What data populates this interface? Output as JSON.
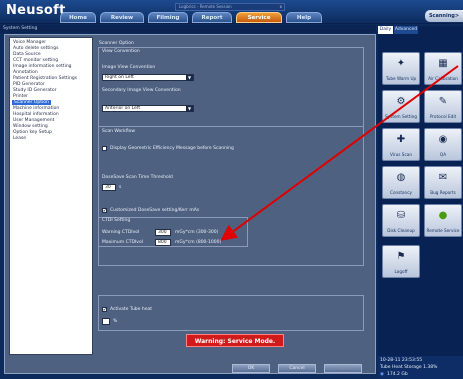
{
  "app": {
    "brand": "Neusoft"
  },
  "nav": {
    "tabs": [
      "Home",
      "Review",
      "Filming",
      "Report",
      "Service",
      "Help"
    ],
    "active": "Service",
    "log_window": "Logbrics - Remote Session",
    "close_glyph": "x",
    "scanning_button": "Scanning>"
  },
  "window_title": "System Setting",
  "tree": {
    "items": [
      "Voice Manager",
      "Auto delete settings",
      "Data Source",
      "CCT monitor setting",
      "Image information setting",
      "Annotation",
      "Patient Registration Settings",
      "PID Generator",
      "Study ID Generator",
      "Printer",
      "Scanner Option",
      "Machine information",
      "Hospital information",
      "User Management",
      "Window setting",
      "Option key Setup",
      "Lease"
    ],
    "selected": "Scanner Option"
  },
  "scanner_option": {
    "header": "Scanner Option",
    "view_convention": {
      "title": "View Convention",
      "image_label": "Image View Convention",
      "image_value": "Right on Left",
      "secondary_label": "Secondary Image View Convention",
      "secondary_value": "Anterior on Left"
    },
    "scan_workflow": {
      "title": "Scan Workflow",
      "display_geometric": "Display Geometric Efficiency Message before Scanning",
      "display_geometric_checked": false,
      "dose_save_label": "DoseSave Scan Time Threshold",
      "dose_save_value": "30",
      "dose_save_unit": "s",
      "customized_dosesave": "Customized DoseSave setting/Kerr mAs",
      "customized_dosesave_checked": true
    },
    "ctdi": {
      "title": "CTDI Setting",
      "warning_label": "Warning CTDIvol",
      "warning_value": "300",
      "warning_range": "mGy*cm (300-300)",
      "maximum_label": "Maximum CTDIvol",
      "maximum_value": "800",
      "maximum_range": "mGy*cm (800-1000)"
    },
    "tube": {
      "activate_label": "Activate Tube heat",
      "activate_checked": true,
      "percent_value": "",
      "percent_unit": "%"
    }
  },
  "warning_banner": "Warning: Service Mode.",
  "buttons": {
    "ok": "OK",
    "cancel": "Cancel",
    "apply": "Apply"
  },
  "right_panel": {
    "tabs": [
      "Daily",
      "Advanced"
    ],
    "active_tab": "Daily",
    "tiles": [
      {
        "label": "Tube Warm Up",
        "icon": "tube-warmup-icon",
        "glyph": "✦"
      },
      {
        "label": "Air Calibration",
        "icon": "air-calibration-icon",
        "glyph": "▦"
      },
      {
        "label": "System Setting",
        "icon": "system-setting-icon",
        "glyph": "⚙"
      },
      {
        "label": "Protocol Edit",
        "icon": "protocol-edit-icon",
        "glyph": "✎"
      },
      {
        "label": "Virus Scan",
        "icon": "virus-scan-icon",
        "glyph": "✚"
      },
      {
        "label": "QA",
        "icon": "qa-icon",
        "glyph": "◉"
      },
      {
        "label": "Constancy",
        "icon": "constancy-icon",
        "glyph": "◍"
      },
      {
        "label": "Bug Reports",
        "icon": "bug-reports-icon",
        "glyph": "✉"
      },
      {
        "label": "Disk Cleanup",
        "icon": "disk-cleanup-icon",
        "glyph": "⛁"
      },
      {
        "label": "Remote Service",
        "icon": "remote-service-icon",
        "glyph": "●"
      },
      {
        "label": "Logoff",
        "icon": "logoff-icon",
        "glyph": "⚑"
      }
    ],
    "status": {
      "datetime": "10-28-11 23:53:55",
      "tube_heat": "Tube Heat Storage 1.38%",
      "disk_value": "174.2",
      "disk_unit": "Gb"
    }
  },
  "colors": {
    "accent": "#f0a03a",
    "warning": "#d11a1a",
    "annotation_arrow": "#e00000"
  }
}
